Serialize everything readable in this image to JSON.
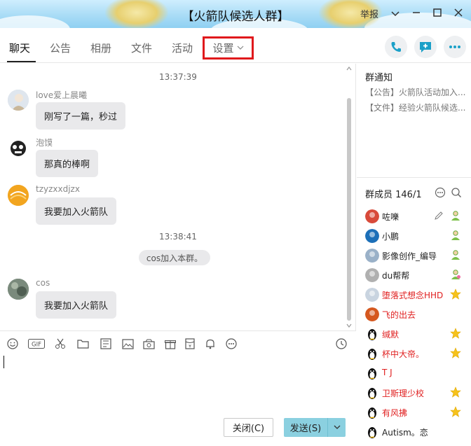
{
  "window": {
    "title": "【火箭队候选人群】",
    "report_label": "举报"
  },
  "tabs": [
    {
      "label": "聊天",
      "active": true
    },
    {
      "label": "公告"
    },
    {
      "label": "相册"
    },
    {
      "label": "文件"
    },
    {
      "label": "活动"
    },
    {
      "label": "设置"
    }
  ],
  "header_icons": [
    "phone-icon",
    "add-message-icon",
    "more-icon"
  ],
  "chat": {
    "time1": "13:37:39",
    "time2": "13:38:41",
    "system_message": "cos加入本群。",
    "messages": [
      {
        "sender": "love爱上晨曦",
        "text": "刚写了一篇，秒过"
      },
      {
        "sender": "泡馍",
        "text": "那真的棒啊"
      },
      {
        "sender": "tzyzxxdjzx",
        "text": "我要加入火箭队"
      },
      {
        "sender": "cos",
        "text": "我要加入火箭队"
      }
    ]
  },
  "toolbar": {
    "icons": [
      "emoji-icon",
      "gif-icon",
      "scissors-icon",
      "folder-icon",
      "image-text-icon",
      "image-icon",
      "shake-icon",
      "gift-icon",
      "red-packet-icon",
      "bell-icon",
      "more-icon",
      "history-icon"
    ],
    "gif_label": "GIF"
  },
  "buttons": {
    "close_label": "关闭(C)",
    "send_label": "发送(S)"
  },
  "notice": {
    "title": "群通知",
    "items": [
      "【公告】火箭队活动加入...",
      "【文件】经验火箭队候选..."
    ]
  },
  "members": {
    "title": "群成员 146/1",
    "list": [
      {
        "name": "咗嚛",
        "color": "#222222",
        "badge": "person-green"
      },
      {
        "name": "小鹏",
        "color": "#222222",
        "badge": "person-green"
      },
      {
        "name": "影像创作_编导",
        "color": "#222222",
        "badge": "person-green"
      },
      {
        "name": "du帮帮",
        "color": "#222222",
        "badge": "person-pink"
      },
      {
        "name": "堕落式想念HHD",
        "color": "#e02020",
        "badge": "star"
      },
      {
        "name": "飞的出去",
        "color": "#e02020",
        "badge": ""
      },
      {
        "name": "缄默",
        "color": "#e02020",
        "badge": "star"
      },
      {
        "name": "杯中大帝。",
        "color": "#e02020",
        "badge": "star"
      },
      {
        "name": "T J",
        "color": "#e02020",
        "badge": ""
      },
      {
        "name": "卫斯理少校",
        "color": "#e02020",
        "badge": "star"
      },
      {
        "name": "有风拂",
        "color": "#e02020",
        "badge": "star"
      },
      {
        "name": "Autism。恋",
        "color": "#222222",
        "badge": ""
      }
    ]
  },
  "colors": {
    "highlight_border": "#e0191c",
    "send_button": "#8bd0e0",
    "admin_red": "#e02020",
    "bubble": "#e9e9eb"
  }
}
